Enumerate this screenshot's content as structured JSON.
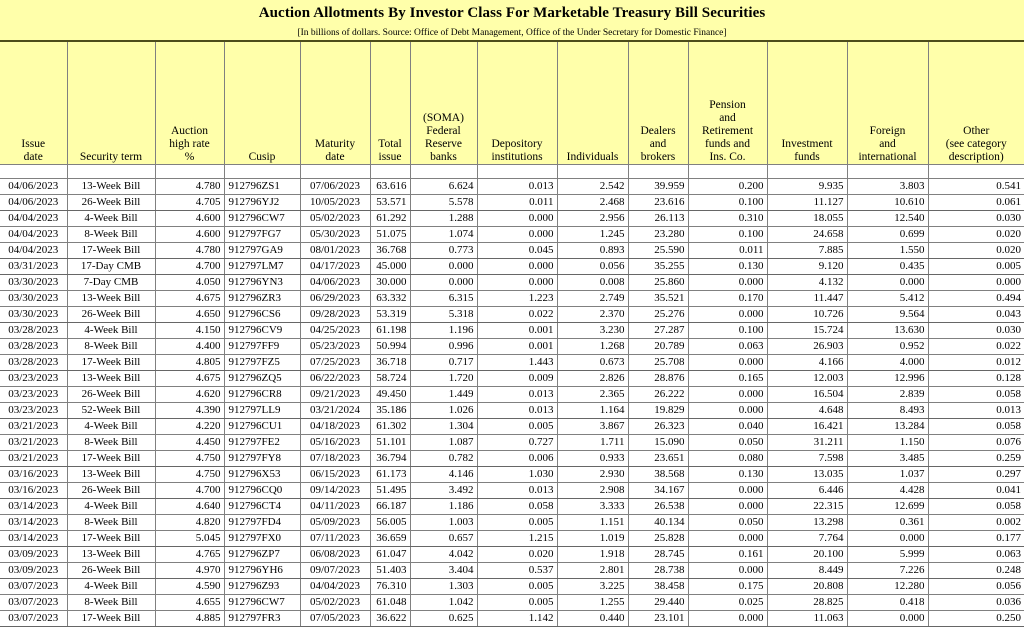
{
  "report": {
    "title": "Auction Allotments By Investor Class For Marketable Treasury Bill Securities",
    "subtitle": "[In billions of dollars. Source: Office of Debt Management, Office of the Under Secretary for Domestic Finance]",
    "header_bg": "#ffffaa",
    "grid_color": "#808080"
  },
  "columns": [
    {
      "key": "issue_date",
      "lines": [
        "Issue",
        "date"
      ]
    },
    {
      "key": "security_term",
      "lines": [
        "Security term"
      ]
    },
    {
      "key": "auction_rate",
      "lines": [
        "Auction",
        "high rate",
        "%"
      ]
    },
    {
      "key": "cusip",
      "lines": [
        "Cusip"
      ]
    },
    {
      "key": "maturity_date",
      "lines": [
        "Maturity",
        "date"
      ]
    },
    {
      "key": "total_issue",
      "lines": [
        "Total",
        "issue"
      ]
    },
    {
      "key": "soma",
      "lines": [
        "(SOMA)",
        "Federal",
        "Reserve",
        "banks"
      ]
    },
    {
      "key": "depository",
      "lines": [
        "Depository",
        "institutions"
      ]
    },
    {
      "key": "individuals",
      "lines": [
        "Individuals"
      ]
    },
    {
      "key": "dealers",
      "lines": [
        "Dealers",
        "and",
        "brokers"
      ]
    },
    {
      "key": "pension",
      "lines": [
        "Pension",
        "and",
        "Retirement",
        "funds and",
        "Ins. Co."
      ]
    },
    {
      "key": "investment",
      "lines": [
        "Investment",
        "funds"
      ]
    },
    {
      "key": "foreign",
      "lines": [
        "Foreign",
        "and",
        "international"
      ]
    },
    {
      "key": "other",
      "lines": [
        "Other",
        "(see category",
        "description)"
      ]
    }
  ],
  "rows": [
    {
      "issue_date": "04/06/2023",
      "security_term": "13-Week Bill",
      "auction_rate": "4.780",
      "cusip": "912796ZS1",
      "maturity_date": "07/06/2023",
      "total_issue": "63.616",
      "soma": "6.624",
      "depository": "0.013",
      "individuals": "2.542",
      "dealers": "39.959",
      "pension": "0.200",
      "investment": "9.935",
      "foreign": "3.803",
      "other": "0.541",
      "group_end": false
    },
    {
      "issue_date": "04/06/2023",
      "security_term": "26-Week Bill",
      "auction_rate": "4.705",
      "cusip": "912796YJ2",
      "maturity_date": "10/05/2023",
      "total_issue": "53.571",
      "soma": "5.578",
      "depository": "0.011",
      "individuals": "2.468",
      "dealers": "23.616",
      "pension": "0.100",
      "investment": "11.127",
      "foreign": "10.610",
      "other": "0.061",
      "group_end": true
    },
    {
      "issue_date": "04/04/2023",
      "security_term": "4-Week Bill",
      "auction_rate": "4.600",
      "cusip": "912796CW7",
      "maturity_date": "05/02/2023",
      "total_issue": "61.292",
      "soma": "1.288",
      "depository": "0.000",
      "individuals": "2.956",
      "dealers": "26.113",
      "pension": "0.310",
      "investment": "18.055",
      "foreign": "12.540",
      "other": "0.030",
      "group_end": false
    },
    {
      "issue_date": "04/04/2023",
      "security_term": "8-Week Bill",
      "auction_rate": "4.600",
      "cusip": "912797FG7",
      "maturity_date": "05/30/2023",
      "total_issue": "51.075",
      "soma": "1.074",
      "depository": "0.000",
      "individuals": "1.245",
      "dealers": "23.280",
      "pension": "0.100",
      "investment": "24.658",
      "foreign": "0.699",
      "other": "0.020",
      "group_end": false
    },
    {
      "issue_date": "04/04/2023",
      "security_term": "17-Week Bill",
      "auction_rate": "4.780",
      "cusip": "912797GA9",
      "maturity_date": "08/01/2023",
      "total_issue": "36.768",
      "soma": "0.773",
      "depository": "0.045",
      "individuals": "0.893",
      "dealers": "25.590",
      "pension": "0.011",
      "investment": "7.885",
      "foreign": "1.550",
      "other": "0.020",
      "group_end": true
    },
    {
      "issue_date": "03/31/2023",
      "security_term": "17-Day CMB",
      "auction_rate": "4.700",
      "cusip": "912797LM7",
      "maturity_date": "04/17/2023",
      "total_issue": "45.000",
      "soma": "0.000",
      "depository": "0.000",
      "individuals": "0.056",
      "dealers": "35.255",
      "pension": "0.130",
      "investment": "9.120",
      "foreign": "0.435",
      "other": "0.005",
      "group_end": true
    },
    {
      "issue_date": "03/30/2023",
      "security_term": "7-Day CMB",
      "auction_rate": "4.050",
      "cusip": "912796YN3",
      "maturity_date": "04/06/2023",
      "total_issue": "30.000",
      "soma": "0.000",
      "depository": "0.000",
      "individuals": "0.008",
      "dealers": "25.860",
      "pension": "0.000",
      "investment": "4.132",
      "foreign": "0.000",
      "other": "0.000",
      "group_end": false
    },
    {
      "issue_date": "03/30/2023",
      "security_term": "13-Week Bill",
      "auction_rate": "4.675",
      "cusip": "912796ZR3",
      "maturity_date": "06/29/2023",
      "total_issue": "63.332",
      "soma": "6.315",
      "depository": "1.223",
      "individuals": "2.749",
      "dealers": "35.521",
      "pension": "0.170",
      "investment": "11.447",
      "foreign": "5.412",
      "other": "0.494",
      "group_end": false
    },
    {
      "issue_date": "03/30/2023",
      "security_term": "26-Week Bill",
      "auction_rate": "4.650",
      "cusip": "912796CS6",
      "maturity_date": "09/28/2023",
      "total_issue": "53.319",
      "soma": "5.318",
      "depository": "0.022",
      "individuals": "2.370",
      "dealers": "25.276",
      "pension": "0.000",
      "investment": "10.726",
      "foreign": "9.564",
      "other": "0.043",
      "group_end": true
    },
    {
      "issue_date": "03/28/2023",
      "security_term": "4-Week Bill",
      "auction_rate": "4.150",
      "cusip": "912796CV9",
      "maturity_date": "04/25/2023",
      "total_issue": "61.198",
      "soma": "1.196",
      "depository": "0.001",
      "individuals": "3.230",
      "dealers": "27.287",
      "pension": "0.100",
      "investment": "15.724",
      "foreign": "13.630",
      "other": "0.030",
      "group_end": false
    },
    {
      "issue_date": "03/28/2023",
      "security_term": "8-Week Bill",
      "auction_rate": "4.400",
      "cusip": "912797FF9",
      "maturity_date": "05/23/2023",
      "total_issue": "50.994",
      "soma": "0.996",
      "depository": "0.001",
      "individuals": "1.268",
      "dealers": "20.789",
      "pension": "0.063",
      "investment": "26.903",
      "foreign": "0.952",
      "other": "0.022",
      "group_end": false
    },
    {
      "issue_date": "03/28/2023",
      "security_term": "17-Week Bill",
      "auction_rate": "4.805",
      "cusip": "912797FZ5",
      "maturity_date": "07/25/2023",
      "total_issue": "36.718",
      "soma": "0.717",
      "depository": "1.443",
      "individuals": "0.673",
      "dealers": "25.708",
      "pension": "0.000",
      "investment": "4.166",
      "foreign": "4.000",
      "other": "0.012",
      "group_end": true
    },
    {
      "issue_date": "03/23/2023",
      "security_term": "13-Week Bill",
      "auction_rate": "4.675",
      "cusip": "912796ZQ5",
      "maturity_date": "06/22/2023",
      "total_issue": "58.724",
      "soma": "1.720",
      "depository": "0.009",
      "individuals": "2.826",
      "dealers": "28.876",
      "pension": "0.165",
      "investment": "12.003",
      "foreign": "12.996",
      "other": "0.128",
      "group_end": false
    },
    {
      "issue_date": "03/23/2023",
      "security_term": "26-Week Bill",
      "auction_rate": "4.620",
      "cusip": "912796CR8",
      "maturity_date": "09/21/2023",
      "total_issue": "49.450",
      "soma": "1.449",
      "depository": "0.013",
      "individuals": "2.365",
      "dealers": "26.222",
      "pension": "0.000",
      "investment": "16.504",
      "foreign": "2.839",
      "other": "0.058",
      "group_end": false
    },
    {
      "issue_date": "03/23/2023",
      "security_term": "52-Week Bill",
      "auction_rate": "4.390",
      "cusip": "912797LL9",
      "maturity_date": "03/21/2024",
      "total_issue": "35.186",
      "soma": "1.026",
      "depository": "0.013",
      "individuals": "1.164",
      "dealers": "19.829",
      "pension": "0.000",
      "investment": "4.648",
      "foreign": "8.493",
      "other": "0.013",
      "group_end": true
    },
    {
      "issue_date": "03/21/2023",
      "security_term": "4-Week Bill",
      "auction_rate": "4.220",
      "cusip": "912796CU1",
      "maturity_date": "04/18/2023",
      "total_issue": "61.302",
      "soma": "1.304",
      "depository": "0.005",
      "individuals": "3.867",
      "dealers": "26.323",
      "pension": "0.040",
      "investment": "16.421",
      "foreign": "13.284",
      "other": "0.058",
      "group_end": false
    },
    {
      "issue_date": "03/21/2023",
      "security_term": "8-Week Bill",
      "auction_rate": "4.450",
      "cusip": "912797FE2",
      "maturity_date": "05/16/2023",
      "total_issue": "51.101",
      "soma": "1.087",
      "depository": "0.727",
      "individuals": "1.711",
      "dealers": "15.090",
      "pension": "0.050",
      "investment": "31.211",
      "foreign": "1.150",
      "other": "0.076",
      "group_end": false
    },
    {
      "issue_date": "03/21/2023",
      "security_term": "17-Week Bill",
      "auction_rate": "4.750",
      "cusip": "912797FY8",
      "maturity_date": "07/18/2023",
      "total_issue": "36.794",
      "soma": "0.782",
      "depository": "0.006",
      "individuals": "0.933",
      "dealers": "23.651",
      "pension": "0.080",
      "investment": "7.598",
      "foreign": "3.485",
      "other": "0.259",
      "group_end": true
    },
    {
      "issue_date": "03/16/2023",
      "security_term": "13-Week Bill",
      "auction_rate": "4.750",
      "cusip": "912796X53",
      "maturity_date": "06/15/2023",
      "total_issue": "61.173",
      "soma": "4.146",
      "depository": "1.030",
      "individuals": "2.930",
      "dealers": "38.568",
      "pension": "0.130",
      "investment": "13.035",
      "foreign": "1.037",
      "other": "0.297",
      "group_end": false
    },
    {
      "issue_date": "03/16/2023",
      "security_term": "26-Week Bill",
      "auction_rate": "4.700",
      "cusip": "912796CQ0",
      "maturity_date": "09/14/2023",
      "total_issue": "51.495",
      "soma": "3.492",
      "depository": "0.013",
      "individuals": "2.908",
      "dealers": "34.167",
      "pension": "0.000",
      "investment": "6.446",
      "foreign": "4.428",
      "other": "0.041",
      "group_end": true
    },
    {
      "issue_date": "03/14/2023",
      "security_term": "4-Week Bill",
      "auction_rate": "4.640",
      "cusip": "912796CT4",
      "maturity_date": "04/11/2023",
      "total_issue": "66.187",
      "soma": "1.186",
      "depository": "0.058",
      "individuals": "3.333",
      "dealers": "26.538",
      "pension": "0.000",
      "investment": "22.315",
      "foreign": "12.699",
      "other": "0.058",
      "group_end": false
    },
    {
      "issue_date": "03/14/2023",
      "security_term": "8-Week Bill",
      "auction_rate": "4.820",
      "cusip": "912797FD4",
      "maturity_date": "05/09/2023",
      "total_issue": "56.005",
      "soma": "1.003",
      "depository": "0.005",
      "individuals": "1.151",
      "dealers": "40.134",
      "pension": "0.050",
      "investment": "13.298",
      "foreign": "0.361",
      "other": "0.002",
      "group_end": false
    },
    {
      "issue_date": "03/14/2023",
      "security_term": "17-Week Bill",
      "auction_rate": "5.045",
      "cusip": "912797FX0",
      "maturity_date": "07/11/2023",
      "total_issue": "36.659",
      "soma": "0.657",
      "depository": "1.215",
      "individuals": "1.019",
      "dealers": "25.828",
      "pension": "0.000",
      "investment": "7.764",
      "foreign": "0.000",
      "other": "0.177",
      "group_end": true
    },
    {
      "issue_date": "03/09/2023",
      "security_term": "13-Week Bill",
      "auction_rate": "4.765",
      "cusip": "912796ZP7",
      "maturity_date": "06/08/2023",
      "total_issue": "61.047",
      "soma": "4.042",
      "depository": "0.020",
      "individuals": "1.918",
      "dealers": "28.745",
      "pension": "0.161",
      "investment": "20.100",
      "foreign": "5.999",
      "other": "0.063",
      "group_end": false
    },
    {
      "issue_date": "03/09/2023",
      "security_term": "26-Week Bill",
      "auction_rate": "4.970",
      "cusip": "912796YH6",
      "maturity_date": "09/07/2023",
      "total_issue": "51.403",
      "soma": "3.404",
      "depository": "0.537",
      "individuals": "2.801",
      "dealers": "28.738",
      "pension": "0.000",
      "investment": "8.449",
      "foreign": "7.226",
      "other": "0.248",
      "group_end": true
    },
    {
      "issue_date": "03/07/2023",
      "security_term": "4-Week Bill",
      "auction_rate": "4.590",
      "cusip": "912796Z93",
      "maturity_date": "04/04/2023",
      "total_issue": "76.310",
      "soma": "1.303",
      "depository": "0.005",
      "individuals": "3.225",
      "dealers": "38.458",
      "pension": "0.175",
      "investment": "20.808",
      "foreign": "12.280",
      "other": "0.056",
      "group_end": false
    },
    {
      "issue_date": "03/07/2023",
      "security_term": "8-Week Bill",
      "auction_rate": "4.655",
      "cusip": "912796CW7",
      "maturity_date": "05/02/2023",
      "total_issue": "61.048",
      "soma": "1.042",
      "depository": "0.005",
      "individuals": "1.255",
      "dealers": "29.440",
      "pension": "0.025",
      "investment": "28.825",
      "foreign": "0.418",
      "other": "0.036",
      "group_end": false
    },
    {
      "issue_date": "03/07/2023",
      "security_term": "17-Week Bill",
      "auction_rate": "4.885",
      "cusip": "912797FR3",
      "maturity_date": "07/05/2023",
      "total_issue": "36.622",
      "soma": "0.625",
      "depository": "1.142",
      "individuals": "0.440",
      "dealers": "23.101",
      "pension": "0.000",
      "investment": "11.063",
      "foreign": "0.000",
      "other": "0.250",
      "group_end": true
    }
  ]
}
